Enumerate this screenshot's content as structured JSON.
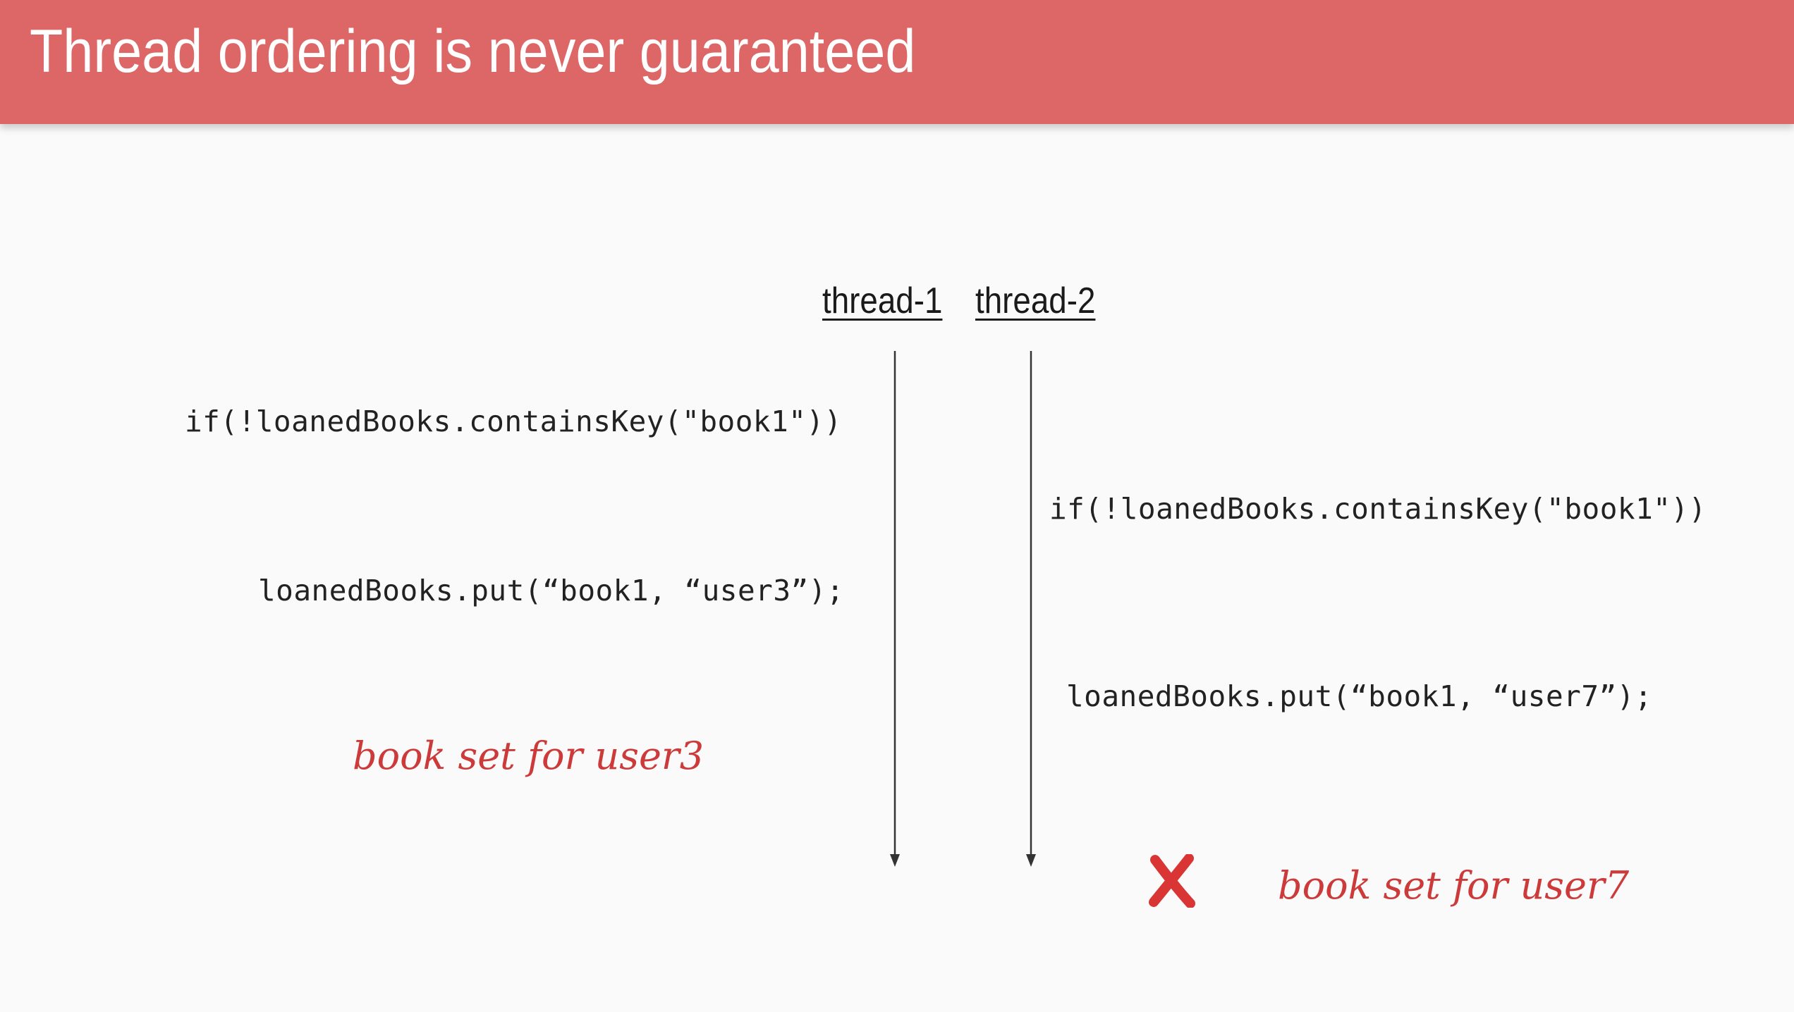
{
  "slide": {
    "title": "Thread ordering is never guaranteed"
  },
  "threads": [
    {
      "label": "thread-1"
    },
    {
      "label": "thread-2"
    }
  ],
  "steps": {
    "t1_check": "if(!loanedBooks.containsKey(\"book1\"))",
    "t2_check": "if(!loanedBooks.containsKey(\"book1\"))",
    "t1_put": "loanedBooks.put(“book1, “user3”);",
    "t2_put": "loanedBooks.put(“book1, “user7”);"
  },
  "notes": {
    "t1_result": "book set for user3",
    "t2_result": "book set for user7"
  },
  "colors": {
    "title_bar": "#dd6666",
    "accent_red": "#cc3a3a",
    "background": "#fafafa"
  },
  "icons": {
    "error": "cross-icon"
  }
}
